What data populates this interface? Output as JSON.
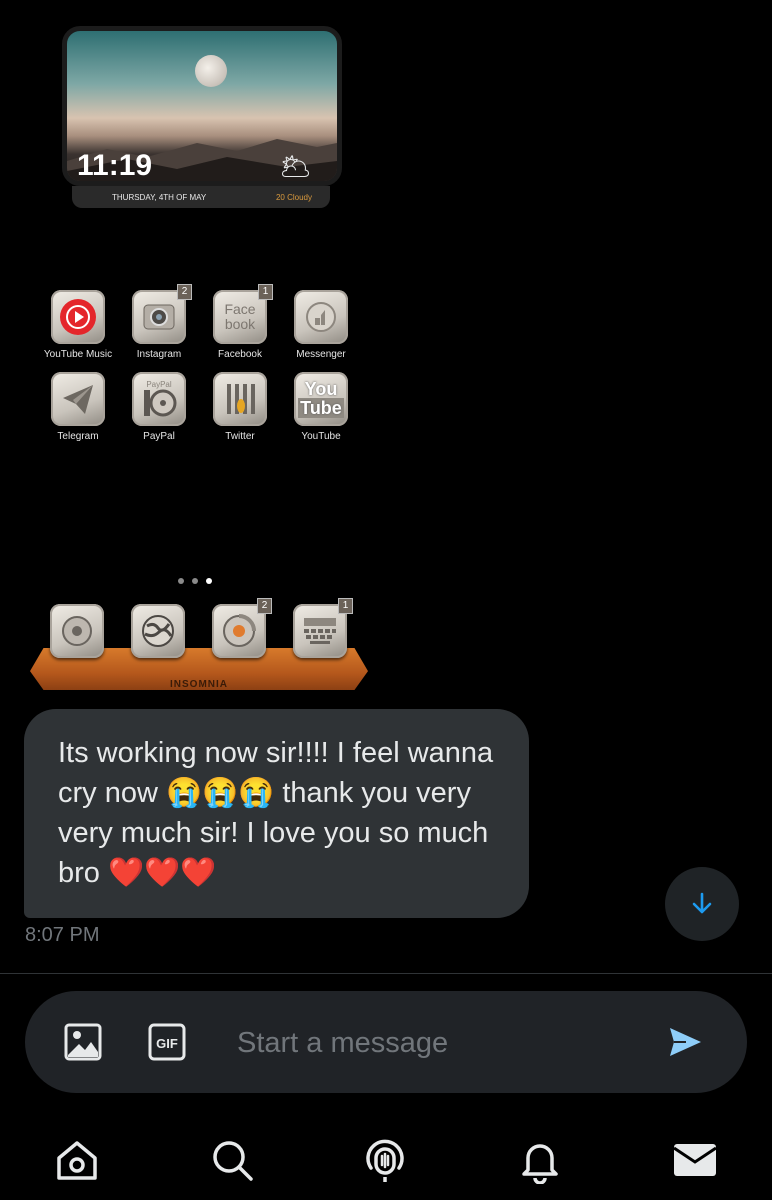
{
  "shared_image": {
    "widget": {
      "time": "11:19",
      "date": "THURSDAY, 4TH OF MAY",
      "weather": "20 Cloudy",
      "weather_icon": "cloud-moon-icon"
    },
    "apps": [
      {
        "label": "YouTube Music",
        "icon": "youtube-music-icon",
        "badge": ""
      },
      {
        "label": "Instagram",
        "icon": "instagram-camera-icon",
        "badge": "2"
      },
      {
        "label": "Facebook",
        "icon": "facebook-icon",
        "badge": "1",
        "glyph": "Face\nbook"
      },
      {
        "label": "Messenger",
        "icon": "messenger-icon",
        "badge": ""
      },
      {
        "label": "Telegram",
        "icon": "telegram-plane-icon",
        "badge": ""
      },
      {
        "label": "PayPal",
        "icon": "paypal-icon",
        "badge": "",
        "glyph": "PayPal"
      },
      {
        "label": "Twitter",
        "icon": "twitter-icon",
        "badge": ""
      },
      {
        "label": "YouTube",
        "icon": "youtube-icon",
        "badge": "",
        "glyph": "You\nTube"
      }
    ],
    "page_dots": 3,
    "active_dot": 2,
    "dock": {
      "label": "INSOMNIA",
      "apps": [
        {
          "icon": "rotary-phone-icon",
          "badge": ""
        },
        {
          "icon": "globe-map-icon",
          "badge": ""
        },
        {
          "icon": "chrome-dial-icon",
          "badge": "2"
        },
        {
          "icon": "typewriter-keyboard-icon",
          "badge": "1"
        }
      ]
    }
  },
  "message": {
    "text": "Its working now sir!!!! I feel wanna cry now 😭😭😭 thank you very very much sir! I love you so much bro ❤️❤️❤️",
    "time": "8:07 PM"
  },
  "composer": {
    "placeholder": "Start a message",
    "gif_label": "GIF"
  },
  "nav": [
    "home-icon",
    "search-icon",
    "spaces-icon",
    "notifications-icon",
    "messages-icon"
  ],
  "colors": {
    "background": "#000000",
    "bubble": "#2f3336",
    "accent": "#1d9bf0",
    "muted": "#71767b"
  }
}
